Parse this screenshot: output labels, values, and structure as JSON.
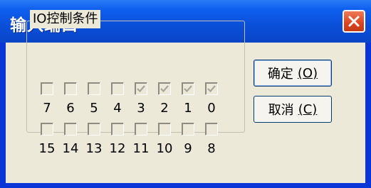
{
  "window": {
    "title": "输入端口"
  },
  "group": {
    "label": "IO控制条件",
    "rows": [
      {
        "bits": [
          {
            "number": "7",
            "checked": false
          },
          {
            "number": "6",
            "checked": false
          },
          {
            "number": "5",
            "checked": false
          },
          {
            "number": "4",
            "checked": false
          },
          {
            "number": "3",
            "checked": true
          },
          {
            "number": "2",
            "checked": true
          },
          {
            "number": "1",
            "checked": true
          },
          {
            "number": "0",
            "checked": true
          }
        ]
      },
      {
        "bits": [
          {
            "number": "15",
            "checked": false
          },
          {
            "number": "14",
            "checked": false
          },
          {
            "number": "13",
            "checked": false
          },
          {
            "number": "12",
            "checked": false
          },
          {
            "number": "11",
            "checked": false
          },
          {
            "number": "10",
            "checked": false
          },
          {
            "number": "9",
            "checked": false
          },
          {
            "number": "8",
            "checked": false
          }
        ]
      }
    ]
  },
  "buttons": {
    "ok": {
      "label": "确定",
      "mnemonic": "(O)"
    },
    "cancel": {
      "label": "取消",
      "mnemonic": "(C)"
    }
  },
  "colors": {
    "titlebar": "#0a4fd8",
    "dialog": "#ece9d8",
    "close": "#d9451f",
    "check_disabled": "#a8a69c"
  }
}
